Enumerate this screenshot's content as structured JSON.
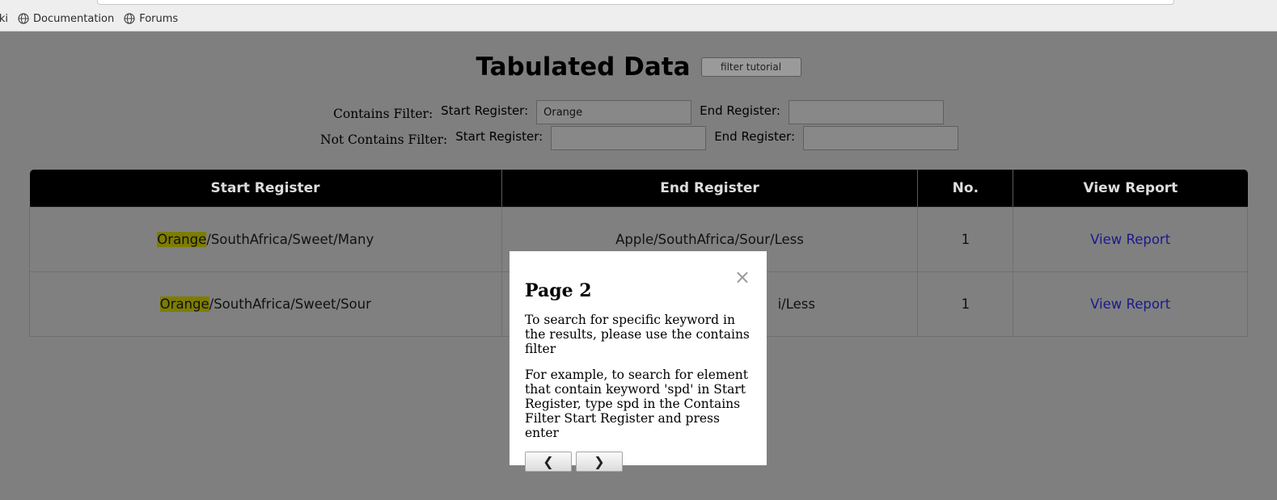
{
  "bookmarks": [
    {
      "label": "Wiki",
      "icon": "globe-icon"
    },
    {
      "label": "Documentation",
      "icon": "globe-icon"
    },
    {
      "label": "Forums",
      "icon": "globe-icon"
    }
  ],
  "page": {
    "title": "Tabulated Data",
    "tutorial_button": "filter tutorial"
  },
  "filters": {
    "contains": {
      "label": "Contains Filter:",
      "start_label": "Start Register:",
      "start_value": "Orange",
      "end_label": "End Register:",
      "end_value": ""
    },
    "not_contains": {
      "label": "Not Contains Filter:",
      "start_label": "Start Register:",
      "start_value": "",
      "end_label": "End Register:",
      "end_value": ""
    }
  },
  "table": {
    "headers": [
      "Start Register",
      "End Register",
      "No.",
      "View Report"
    ],
    "rows": [
      {
        "start_highlight": "Orange",
        "start_rest": "/SouthAfrica/Sweet/Many",
        "end": "Apple/SouthAfrica/Sour/Less",
        "no": "1",
        "link": "View Report"
      },
      {
        "start_highlight": "Orange",
        "start_rest": "/SouthAfrica/Sweet/Sour",
        "end": "i/Less",
        "no": "1",
        "link": "View Report"
      }
    ]
  },
  "modal": {
    "title": "Page 2",
    "close": "×",
    "paragraph1": "To search for specific keyword in the results, please use the contains filter",
    "paragraph2": "For example, to search for element that contain keyword 'spd' in Start Register, type spd in the Contains Filter Start Register and press enter",
    "prev": "❮",
    "next": "❯"
  },
  "colors": {
    "overlay": "#7f7f7f",
    "header_bg": "#000000",
    "highlight": "#7d7d00",
    "link": "#1a1a8c"
  }
}
